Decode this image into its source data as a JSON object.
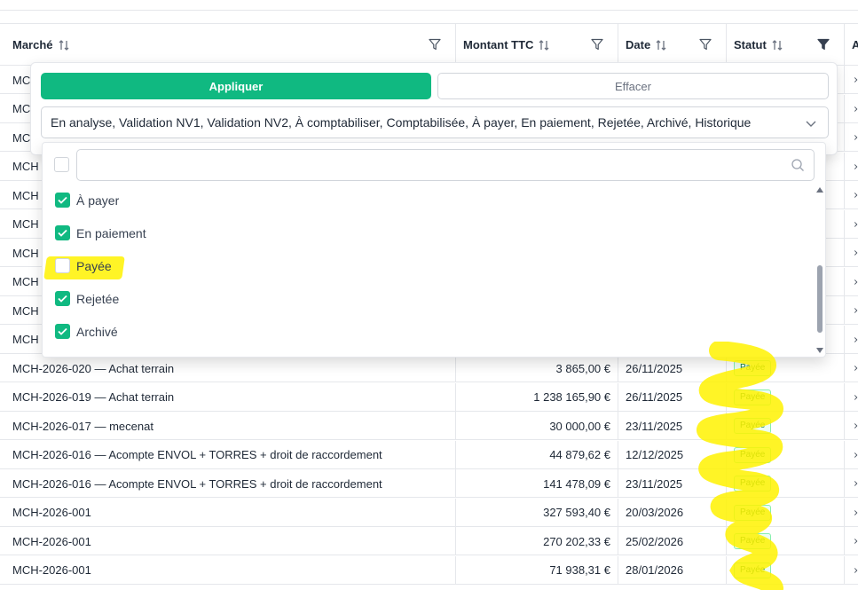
{
  "table": {
    "headers": {
      "marche": "Marché",
      "montant": "Montant TTC",
      "date": "Date",
      "statut": "Statut",
      "extra": "A"
    },
    "hidden_rows_prefix": [
      "MC",
      "MC",
      "MC",
      "MCH",
      "MCH",
      "MCH",
      "MCH",
      "MCH",
      "MCH",
      "MCH"
    ],
    "rows": [
      {
        "marche": "MCH-2026-020 — Achat terrain",
        "montant": "3 865,00 €",
        "date": "26/11/2025",
        "statut": "Payée"
      },
      {
        "marche": "MCH-2026-019 — Achat terrain",
        "montant": "1 238 165,90 €",
        "date": "26/11/2025",
        "statut": "Payée"
      },
      {
        "marche": "MCH-2026-017 — mecenat",
        "montant": "30 000,00 €",
        "date": "23/11/2025",
        "statut": "Payée"
      },
      {
        "marche": "MCH-2026-016 — Acompte ENVOL + TORRES + droit de raccordement",
        "montant": "44 879,62 €",
        "date": "12/12/2025",
        "statut": "Payée"
      },
      {
        "marche": "MCH-2026-016 — Acompte ENVOL + TORRES + droit de raccordement",
        "montant": "141 478,09 €",
        "date": "23/11/2025",
        "statut": "Payée"
      },
      {
        "marche": "MCH-2026-001",
        "montant": "327 593,40 €",
        "date": "20/03/2026",
        "statut": "Payée"
      },
      {
        "marche": "MCH-2026-001",
        "montant": "270 202,33 €",
        "date": "25/02/2026",
        "statut": "Payée"
      },
      {
        "marche": "MCH-2026-001",
        "montant": "71 938,31 €",
        "date": "28/01/2026",
        "statut": "Payée"
      }
    ]
  },
  "filter": {
    "apply_label": "Appliquer",
    "clear_label": "Effacer",
    "selected_text": "En analyse, Validation NV1, Validation NV2, À comptabiliser, Comptabilisée, À payer, En paiement, Rejetée, Archivé, Historique",
    "search_placeholder": "",
    "options": [
      {
        "label": "À payer",
        "checked": true
      },
      {
        "label": "En paiement",
        "checked": true
      },
      {
        "label": "Payée",
        "checked": false
      },
      {
        "label": "Rejetée",
        "checked": true
      },
      {
        "label": "Archivé",
        "checked": true
      }
    ]
  },
  "colors": {
    "accent": "#10b981",
    "badge_text": "#15803d",
    "highlight": "#fff200"
  },
  "icons": [
    "sort-icon",
    "filter-icon",
    "filter-active-icon",
    "chevron-down-icon",
    "search-icon",
    "check-icon",
    "chevron-right-icon"
  ]
}
